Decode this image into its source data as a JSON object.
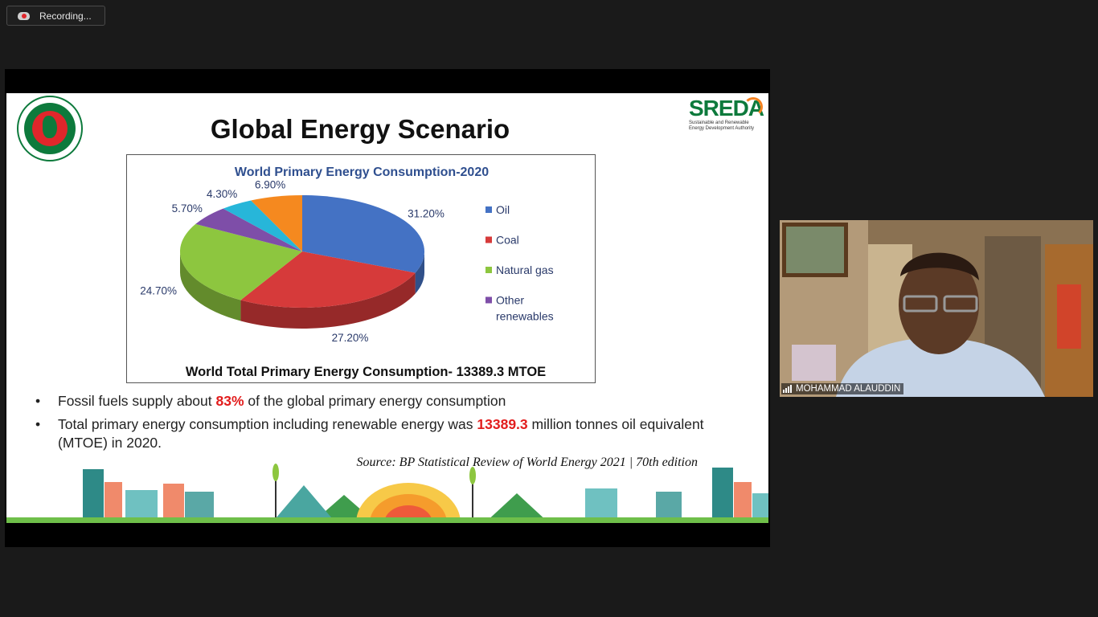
{
  "recording": {
    "label": "Recording..."
  },
  "slide": {
    "title": "Global Energy Scenario",
    "logo_right": {
      "name": "SREDA",
      "subtitle_line1": "Sustainable and Renewable",
      "subtitle_line2": "Energy Development Authority"
    },
    "bullets": [
      {
        "pre": "Fossil fuels supply about ",
        "highlight": "83%",
        "post": " of the global primary energy consumption"
      },
      {
        "pre": "Total primary energy consumption including renewable energy was ",
        "highlight": "13389.3",
        "post": " million tonnes oil equivalent (MTOE) in 2020."
      }
    ],
    "source": "Source: BP Statistical Review of World Energy 2021 | 70th edition"
  },
  "chart_data": {
    "type": "pie",
    "title": "World Primary Energy Consumption-2020",
    "footer": "World Total Primary Energy Consumption- 13389.3 MTOE",
    "slices": [
      {
        "label": "Oil",
        "value": 31.2,
        "display": "31.20%",
        "color": "#4472c4"
      },
      {
        "label": "Coal",
        "value": 27.2,
        "display": "27.20%",
        "color": "#d63a3a"
      },
      {
        "label": "Natural gas",
        "value": 24.7,
        "display": "24.70%",
        "color": "#8dc63f"
      },
      {
        "label": "Other renewables",
        "value": 5.7,
        "display": "5.70%",
        "color": "#7e4ea8"
      },
      {
        "label": "",
        "value": 4.3,
        "display": "4.30%",
        "color": "#27b6d9"
      },
      {
        "label": "",
        "value": 6.9,
        "display": "6.90%",
        "color": "#f5891f"
      }
    ],
    "legend": [
      {
        "label": "Oil",
        "color": "#4472c4"
      },
      {
        "label": "Coal",
        "color": "#d63a3a"
      },
      {
        "label": "Natural gas",
        "color": "#8dc63f"
      },
      {
        "label": "Other renewables",
        "color": "#7e4ea8"
      }
    ],
    "legend_position": "right"
  },
  "video": {
    "participant_name": "MOHAMMAD ALAUDDIN"
  }
}
